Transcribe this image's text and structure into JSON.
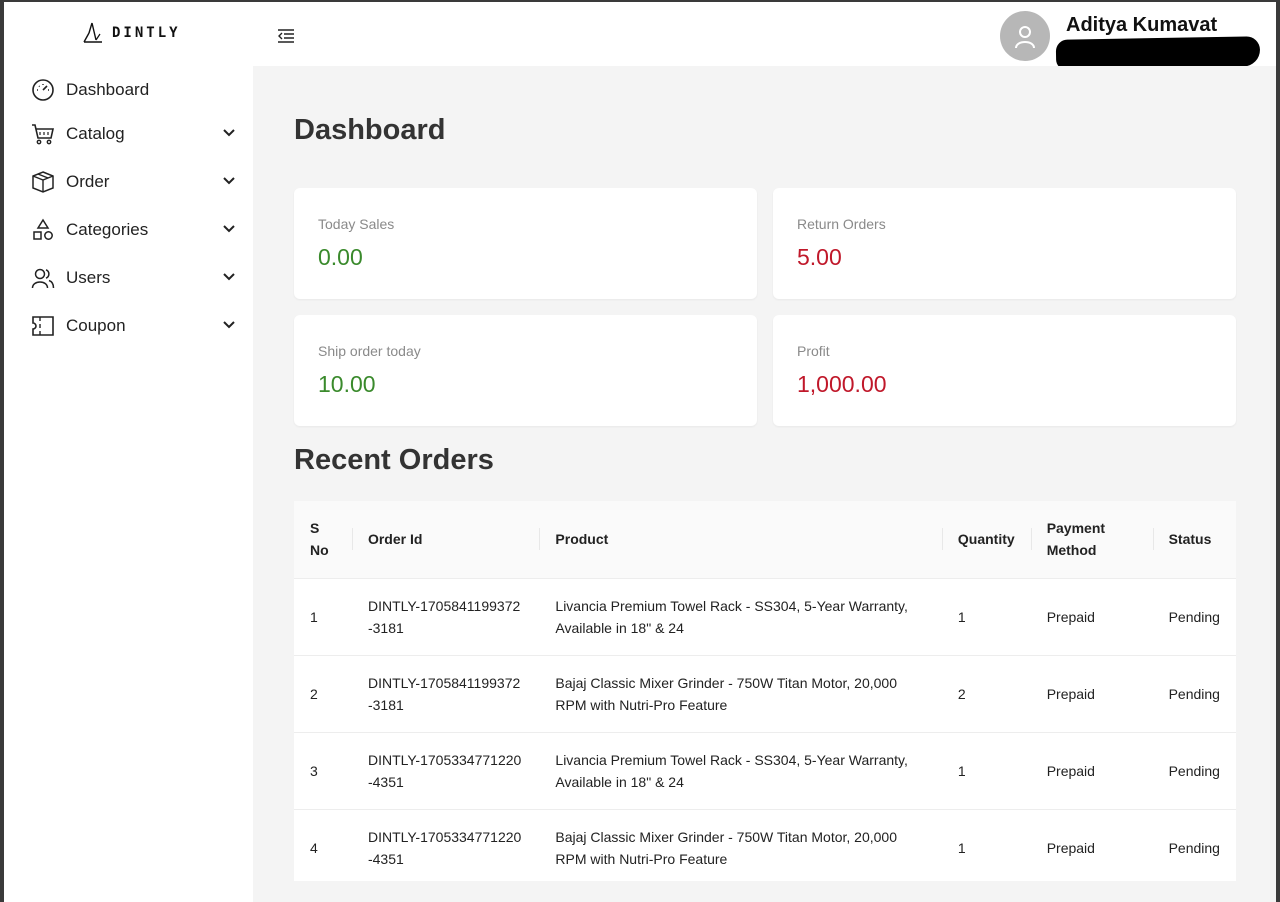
{
  "header": {
    "logo_text": "DINTLY",
    "user_name": "Aditya Kumavat"
  },
  "sidebar": {
    "items": [
      {
        "label": "Dashboard",
        "icon": "speedometer-icon",
        "has_chevron": false
      },
      {
        "label": "Catalog",
        "icon": "cart-icon",
        "has_chevron": true
      },
      {
        "label": "Order",
        "icon": "box-icon",
        "has_chevron": true
      },
      {
        "label": "Categories",
        "icon": "shapes-icon",
        "has_chevron": true
      },
      {
        "label": "Users",
        "icon": "users-icon",
        "has_chevron": true
      },
      {
        "label": "Coupon",
        "icon": "coupon-icon",
        "has_chevron": true
      }
    ]
  },
  "main": {
    "title": "Dashboard",
    "cards": [
      {
        "label": "Today Sales",
        "value": "0.00",
        "color": "#3a8a2c"
      },
      {
        "label": "Return Orders",
        "value": "5.00",
        "color": "#c0182a"
      },
      {
        "label": "Ship order today",
        "value": "10.00",
        "color": "#3a8a2c"
      },
      {
        "label": "Profit",
        "value": "1,000.00",
        "color": "#c0182a"
      }
    ],
    "recent_orders": {
      "title": "Recent Orders",
      "columns": [
        "S No",
        "Order Id",
        "Product",
        "Quantity",
        "Payment Method",
        "Status"
      ],
      "rows": [
        {
          "sno": "1",
          "order_id": "DINTLY-1705841199372-3181",
          "product": "Livancia Premium Towel Rack - SS304, 5-Year Warranty, Available in 18\" & 24",
          "quantity": "1",
          "payment": "Prepaid",
          "status": "Pending"
        },
        {
          "sno": "2",
          "order_id": "DINTLY-1705841199372-3181",
          "product": "Bajaj Classic Mixer Grinder - 750W Titan Motor, 20,000 RPM with Nutri-Pro Feature",
          "quantity": "2",
          "payment": "Prepaid",
          "status": "Pending"
        },
        {
          "sno": "3",
          "order_id": "DINTLY-1705334771220-4351",
          "product": "Livancia Premium Towel Rack - SS304, 5-Year Warranty, Available in 18\" & 24",
          "quantity": "1",
          "payment": "Prepaid",
          "status": "Pending"
        },
        {
          "sno": "4",
          "order_id": "DINTLY-1705334771220-4351",
          "product": "Bajaj Classic Mixer Grinder - 750W Titan Motor, 20,000 RPM with Nutri-Pro Feature",
          "quantity": "1",
          "payment": "Prepaid",
          "status": "Pending"
        }
      ]
    }
  },
  "colors": {
    "positive": "#3a8a2c",
    "negative": "#c0182a",
    "main_bg": "#f4f4f4"
  }
}
